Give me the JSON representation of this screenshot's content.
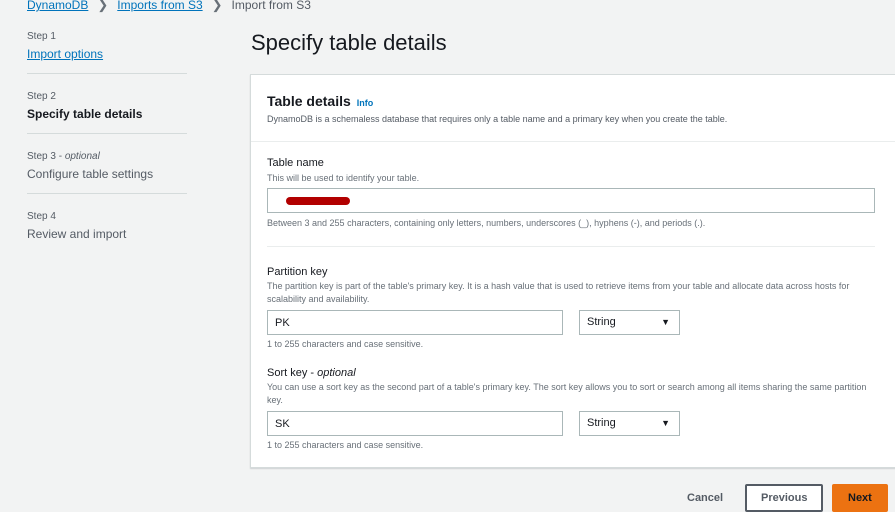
{
  "breadcrumb": {
    "items": [
      "DynamoDB",
      "Imports from S3"
    ],
    "current": "Import from S3"
  },
  "steps": [
    {
      "num": "Step 1",
      "label": "Import options"
    },
    {
      "num": "Step 2",
      "label": "Specify table details"
    },
    {
      "num": "Step 3",
      "optional": "optional",
      "label": "Configure table settings"
    },
    {
      "num": "Step 4",
      "label": "Review and import"
    }
  ],
  "page_title": "Specify table details",
  "table_details": {
    "title": "Table details",
    "info_label": "Info",
    "description": "DynamoDB is a schemaless database that requires only a table name and a primary key when you create the table."
  },
  "table_name": {
    "label": "Table name",
    "description": "This will be used to identify your table.",
    "value": "",
    "constraint": "Between 3 and 255 characters, containing only letters, numbers, underscores (_), hyphens (-), and periods (.)."
  },
  "partition_key": {
    "label": "Partition key",
    "description": "The partition key is part of the table's primary key. It is a hash value that is used to retrieve items from your table and allocate data across hosts for scalability and availability.",
    "value": "PK",
    "type": "String",
    "constraint": "1 to 255 characters and case sensitive."
  },
  "sort_key": {
    "label": "Sort key",
    "optional": "optional",
    "description": "You can use a sort key as the second part of a table's primary key. The sort key allows you to sort or search among all items sharing the same partition key.",
    "value": "SK",
    "type": "String",
    "constraint": "1 to 255 characters and case sensitive."
  },
  "footer": {
    "cancel": "Cancel",
    "previous": "Previous",
    "next": "Next"
  }
}
